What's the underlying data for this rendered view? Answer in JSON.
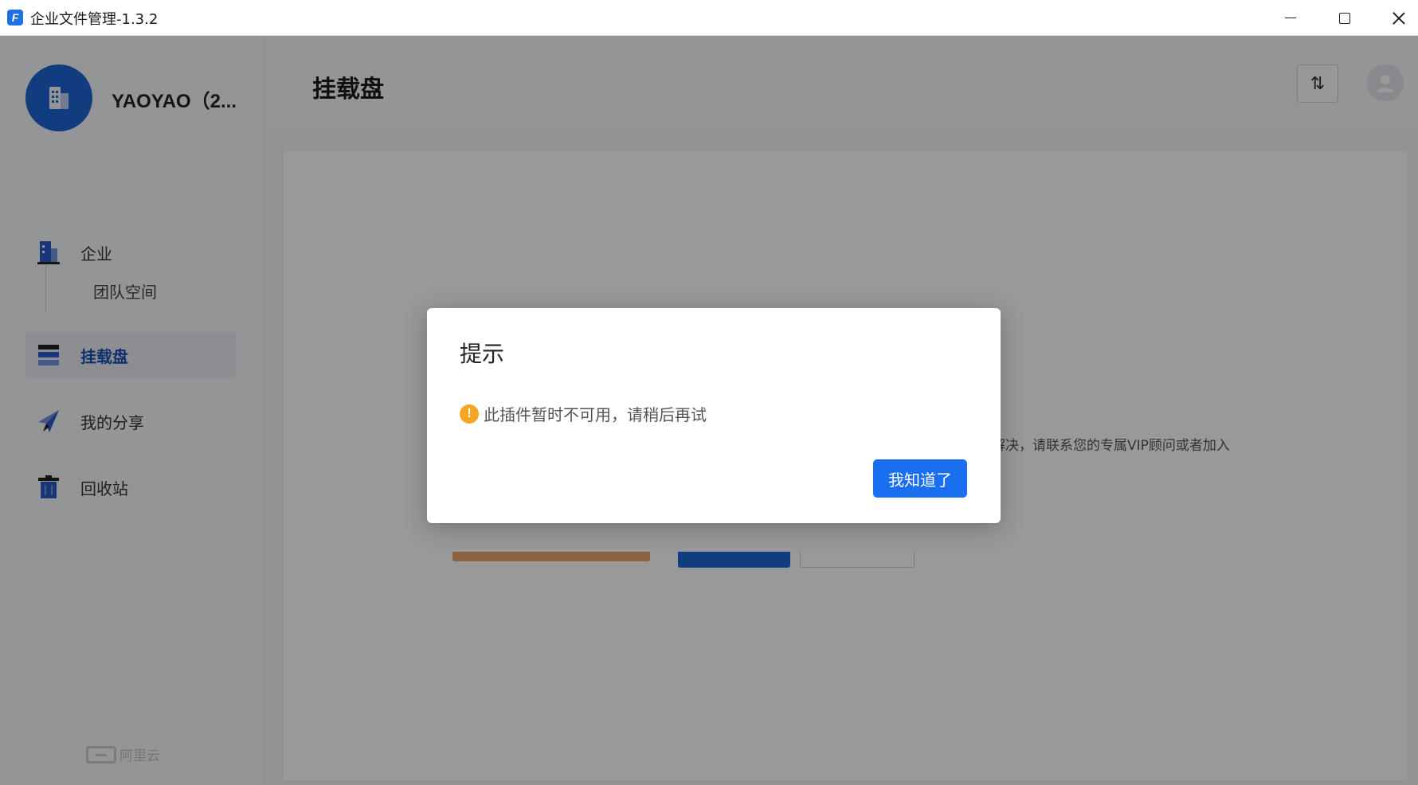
{
  "window": {
    "title": "企业文件管理-1.3.2",
    "app_icon_letter": "F"
  },
  "sidebar": {
    "org_name": "YAOYAO（2...",
    "items": [
      {
        "label": "企业",
        "icon": "building-icon"
      },
      {
        "label": "挂载盘",
        "icon": "drive-icon",
        "active": true
      },
      {
        "label": "我的分享",
        "icon": "paper-plane-icon"
      },
      {
        "label": "回收站",
        "icon": "trash-icon"
      }
    ],
    "sub_items": [
      {
        "label": "团队空间"
      }
    ],
    "footer_brand": "阿里云"
  },
  "header": {
    "title": "挂载盘",
    "sort_icon_glyph": "⇅"
  },
  "background": {
    "partial_text": "解决，请联系您的专属VIP顾问或者加入"
  },
  "dialog": {
    "title": "提示",
    "message": "此插件暂时不可用，请稍后再试",
    "warn_glyph": "!",
    "confirm_label": "我知道了"
  },
  "colors": {
    "accent": "#1a6ff0",
    "warning": "#f5a623",
    "active_nav": "#1b4fb8"
  }
}
